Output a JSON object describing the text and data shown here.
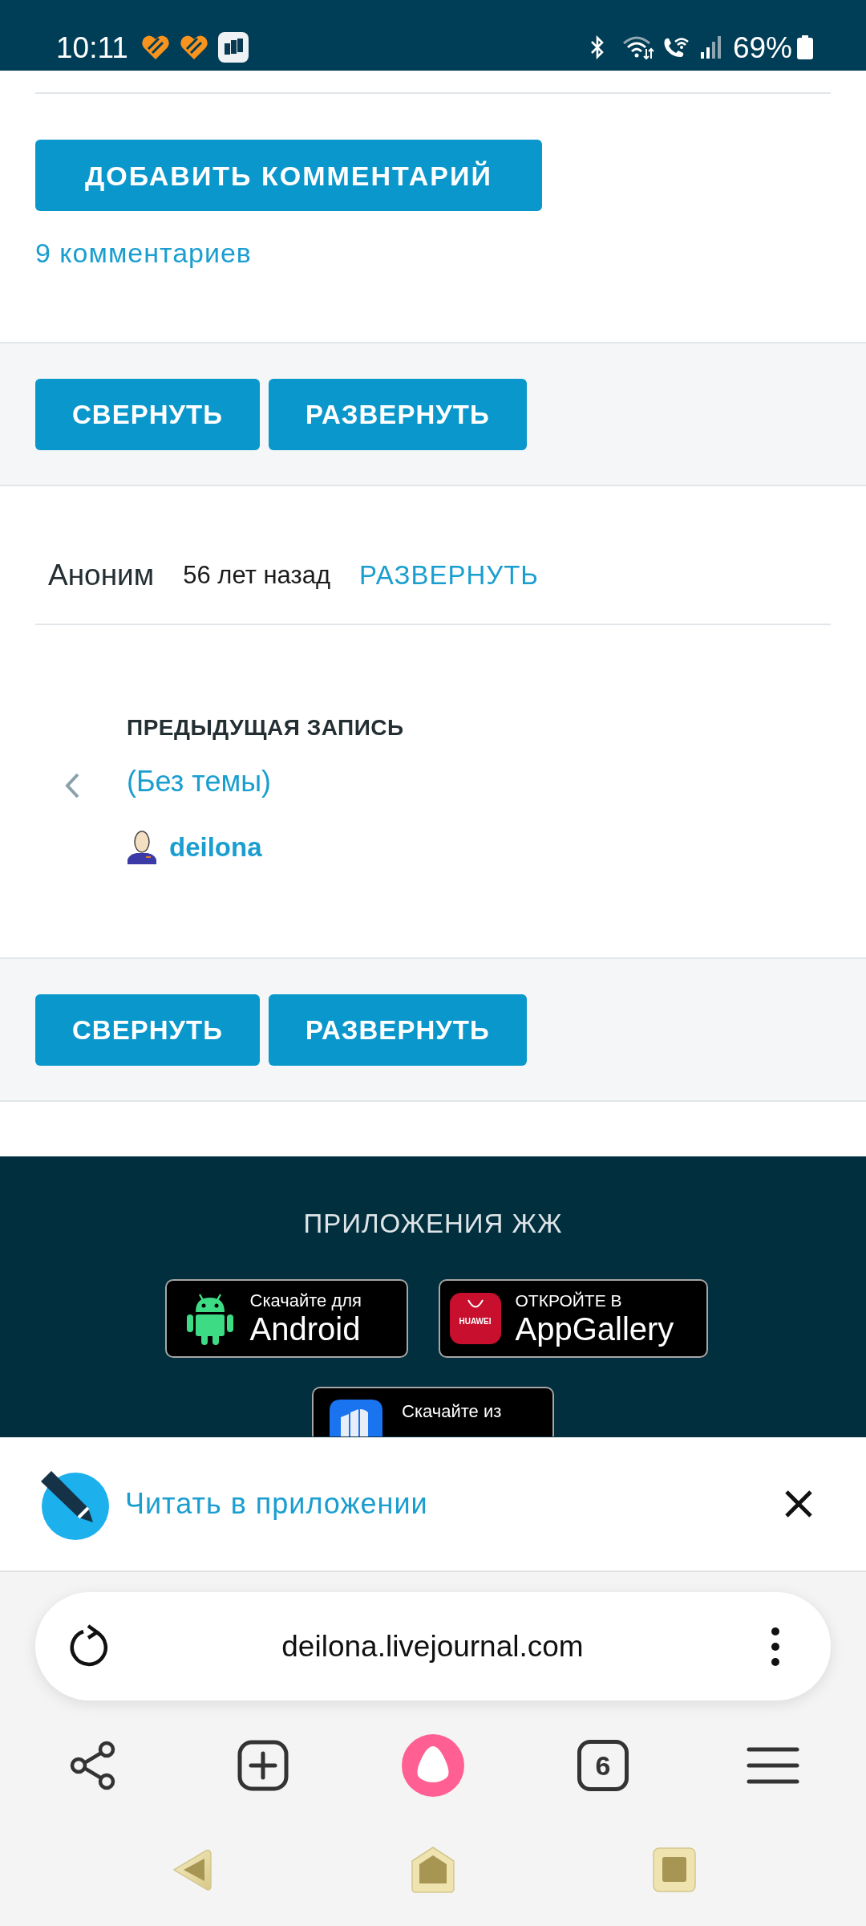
{
  "status_bar": {
    "time": "10:11",
    "battery": "69%"
  },
  "comments": {
    "add_button": "ДОБАВИТЬ КОММЕНТАРИЙ",
    "count_link": "9 комментариев"
  },
  "toolbar_top": {
    "buttons": [
      "СВЕРНУТЬ",
      "РАЗВЕРНУТЬ"
    ]
  },
  "comment": {
    "author": "Аноним",
    "time": "56 лет назад",
    "expand_link": "РАЗВЕРНУТЬ"
  },
  "previous_entry": {
    "heading": "ПРЕДЫДУЩАЯ ЗАПИСЬ",
    "title": "(Без темы)",
    "author": "deilona"
  },
  "toolbar_bottom": {
    "buttons": [
      "СВЕРНУТЬ",
      "РАЗВЕРНУТЬ"
    ]
  },
  "footer": {
    "title": "ПРИЛОЖЕНИЯ ЖЖ",
    "badges": [
      {
        "kind": "android",
        "caption": "Скачайте для",
        "name": "Android"
      },
      {
        "kind": "appgallery",
        "logo_text": "HUAWEI",
        "caption": "ОТКРОЙТЕ В",
        "name": "AppGallery"
      },
      {
        "kind": "rustore",
        "caption": "Скачайте из"
      }
    ]
  },
  "app_banner": {
    "text": "Читать в приложении"
  },
  "browser": {
    "url": "deilona.livejournal.com",
    "tab_count": "6"
  }
}
